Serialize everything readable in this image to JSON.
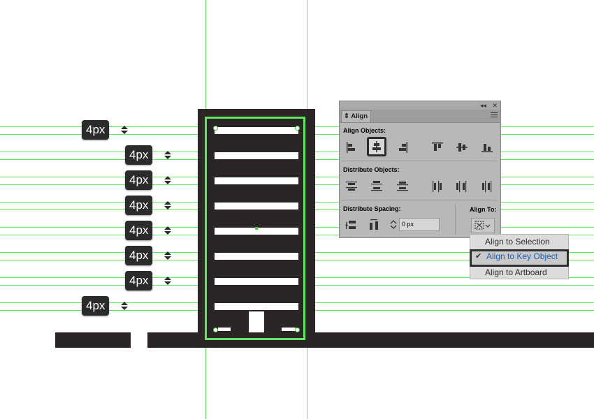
{
  "spacing_labels": [
    "4px",
    "4px",
    "4px",
    "4px",
    "4px",
    "4px",
    "4px",
    "4px"
  ],
  "panel": {
    "collapse_glyph": "◂◂",
    "close_glyph": "✕",
    "tab_label": "Align",
    "tab_arrows": "⇕",
    "align_objects_label": "Align Objects:",
    "distribute_objects_label": "Distribute Objects:",
    "distribute_spacing_label": "Distribute Spacing:",
    "align_to_label": "Align To:",
    "spacing_value": "0 px"
  },
  "dropdown": {
    "items": [
      {
        "label": "Align to Selection",
        "selected": false
      },
      {
        "label": "Align to Key Object",
        "selected": true
      },
      {
        "label": "Align to Artboard",
        "selected": false
      }
    ],
    "check_glyph": "✔"
  },
  "colors": {
    "guide": "#5fe85f",
    "shape": "#2b2526",
    "panel_bg": "#b8b8b8",
    "selected_text": "#1e5fb4"
  }
}
